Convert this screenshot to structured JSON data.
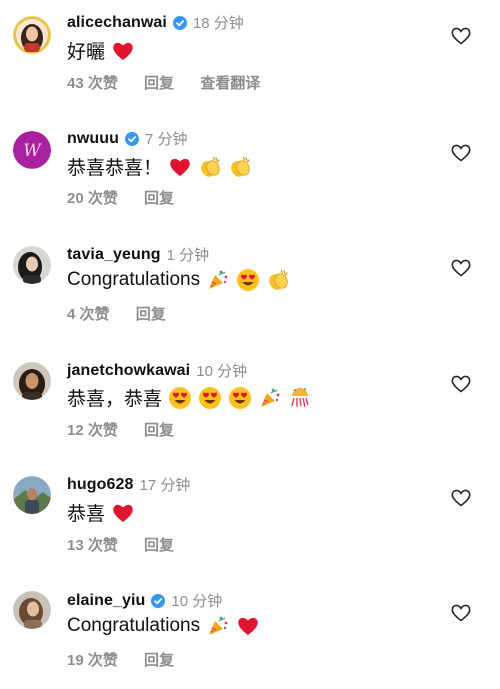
{
  "comments": [
    {
      "username": "alicechanwai",
      "verified": true,
      "time": "18 分钟",
      "text": "好曬",
      "emojis": [
        "red-heart"
      ],
      "likes": "43 次赞",
      "reply": "回复",
      "translate": "查看翻译",
      "avatar": "portrait-a"
    },
    {
      "username": "nwuuu",
      "verified": true,
      "time": "7 分钟",
      "text": "恭喜恭喜！",
      "emojis": [
        "red-heart",
        "clapping-hands",
        "clapping-hands"
      ],
      "likes": "20 次赞",
      "reply": "回复",
      "avatar": "logo-w"
    },
    {
      "username": "tavia_yeung",
      "verified": false,
      "time": "1 分钟",
      "text": "Congratulations",
      "emojis": [
        "party-popper",
        "heart-eyes",
        "clapping-hands"
      ],
      "likes": "4 次赞",
      "reply": "回复",
      "avatar": "portrait-b"
    },
    {
      "username": "janetchowkawai",
      "verified": false,
      "time": "10 分钟",
      "text": "恭喜，恭喜",
      "emojis": [
        "heart-eyes",
        "heart-eyes",
        "heart-eyes",
        "party-popper",
        "confetti-ball"
      ],
      "likes": "12 次赞",
      "reply": "回复",
      "avatar": "portrait-c"
    },
    {
      "username": "hugo628",
      "verified": false,
      "time": "17 分钟",
      "text": "恭喜",
      "emojis": [
        "red-heart"
      ],
      "likes": "13 次赞",
      "reply": "回复",
      "avatar": "portrait-d"
    },
    {
      "username": "elaine_yiu",
      "verified": true,
      "time": "10 分钟",
      "text": "Congratulations",
      "emojis": [
        "party-popper",
        "red-heart"
      ],
      "likes": "19 次赞",
      "reply": "回复",
      "avatar": "portrait-e"
    }
  ],
  "colors": {
    "verified": "#3897f0",
    "secondary": "#8e8e8e",
    "heart": "#e0152d"
  }
}
